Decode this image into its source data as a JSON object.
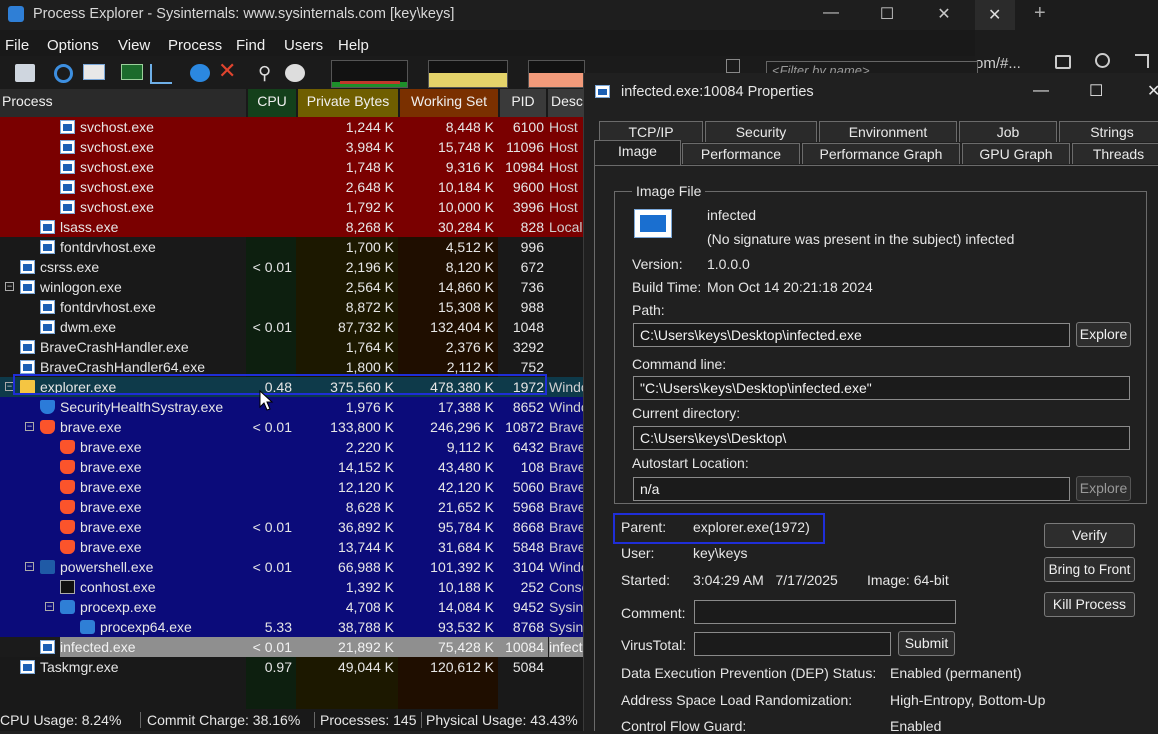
{
  "window": {
    "title": "Process Explorer - Sysinternals: www.sysinternals.com [key\\keys]",
    "minimize": "—",
    "maximize": "☐",
    "close": "✕"
  },
  "browser": {
    "close_tab": "✕",
    "new_tab": "+",
    "url_fragment": "om/#...",
    "filter_placeholder": "<Filter by name>"
  },
  "menu": [
    "File",
    "Options",
    "View",
    "Process",
    "Find",
    "Users",
    "Help"
  ],
  "columns": {
    "process": "Process",
    "cpu": "CPU",
    "private": "Private Bytes",
    "working": "Working Set",
    "pid": "PID",
    "desc": "Desc"
  },
  "colors": {
    "service": "#7a0000",
    "user": "#0b0b7a",
    "immersive": "#0e3a4a",
    "new": "#8f8f8f",
    "cpu_col": "#0f2a12",
    "priv_col": "#3a3000",
    "ws_col": "#3d1a00"
  },
  "processes": [
    {
      "name": "svchost.exe",
      "cpu": "",
      "private": "1,244 K",
      "working": "8,448 K",
      "pid": "6100",
      "desc": "Host",
      "indent": 60,
      "icon": "app",
      "color": "service"
    },
    {
      "name": "svchost.exe",
      "cpu": "",
      "private": "3,984 K",
      "working": "15,748 K",
      "pid": "11096",
      "desc": "Host",
      "indent": 60,
      "icon": "app",
      "color": "service"
    },
    {
      "name": "svchost.exe",
      "cpu": "",
      "private": "1,748 K",
      "working": "9,316 K",
      "pid": "10984",
      "desc": "Host",
      "indent": 60,
      "icon": "app",
      "color": "service"
    },
    {
      "name": "svchost.exe",
      "cpu": "",
      "private": "2,648 K",
      "working": "10,184 K",
      "pid": "9600",
      "desc": "Host",
      "indent": 60,
      "icon": "app",
      "color": "service"
    },
    {
      "name": "svchost.exe",
      "cpu": "",
      "private": "1,792 K",
      "working": "10,000 K",
      "pid": "3996",
      "desc": "Host",
      "indent": 60,
      "icon": "app",
      "color": "service"
    },
    {
      "name": "lsass.exe",
      "cpu": "",
      "private": "8,268 K",
      "working": "30,284 K",
      "pid": "828",
      "desc": "Local",
      "indent": 40,
      "icon": "app",
      "color": "service"
    },
    {
      "name": "fontdrvhost.exe",
      "cpu": "",
      "private": "1,700 K",
      "working": "4,512 K",
      "pid": "996",
      "desc": "",
      "indent": 40,
      "icon": "app",
      "color": ""
    },
    {
      "name": "csrss.exe",
      "cpu": "< 0.01",
      "private": "2,196 K",
      "working": "8,120 K",
      "pid": "672",
      "desc": "",
      "indent": 20,
      "icon": "app",
      "color": ""
    },
    {
      "name": "winlogon.exe",
      "cpu": "",
      "private": "2,564 K",
      "working": "14,860 K",
      "pid": "736",
      "desc": "",
      "indent": 20,
      "icon": "app",
      "color": "",
      "toggle": "−"
    },
    {
      "name": "fontdrvhost.exe",
      "cpu": "",
      "private": "8,872 K",
      "working": "15,308 K",
      "pid": "988",
      "desc": "",
      "indent": 40,
      "icon": "app",
      "color": ""
    },
    {
      "name": "dwm.exe",
      "cpu": "< 0.01",
      "private": "87,732 K",
      "working": "132,404 K",
      "pid": "1048",
      "desc": "",
      "indent": 40,
      "icon": "app",
      "color": ""
    },
    {
      "name": "BraveCrashHandler.exe",
      "cpu": "",
      "private": "1,764 K",
      "working": "2,376 K",
      "pid": "3292",
      "desc": "",
      "indent": 20,
      "icon": "app",
      "color": ""
    },
    {
      "name": "BraveCrashHandler64.exe",
      "cpu": "",
      "private": "1,800 K",
      "working": "2,112 K",
      "pid": "752",
      "desc": "",
      "indent": 20,
      "icon": "app",
      "color": ""
    },
    {
      "name": "explorer.exe",
      "cpu": "0.48",
      "private": "375,560 K",
      "working": "478,380 K",
      "pid": "1972",
      "desc": "Windo",
      "indent": 20,
      "icon": "folder",
      "color": "immersive",
      "toggle": "−"
    },
    {
      "name": "SecurityHealthSystray.exe",
      "cpu": "",
      "private": "1,976 K",
      "working": "17,388 K",
      "pid": "8652",
      "desc": "Windo",
      "indent": 40,
      "icon": "shield",
      "color": "user"
    },
    {
      "name": "brave.exe",
      "cpu": "< 0.01",
      "private": "133,800 K",
      "working": "246,296 K",
      "pid": "10872",
      "desc": "Brave",
      "indent": 40,
      "icon": "brave",
      "color": "user",
      "toggle": "−"
    },
    {
      "name": "brave.exe",
      "cpu": "",
      "private": "2,220 K",
      "working": "9,112 K",
      "pid": "6432",
      "desc": "Brave",
      "indent": 60,
      "icon": "brave",
      "color": "user"
    },
    {
      "name": "brave.exe",
      "cpu": "",
      "private": "14,152 K",
      "working": "43,480 K",
      "pid": "108",
      "desc": "Brave",
      "indent": 60,
      "icon": "brave",
      "color": "user"
    },
    {
      "name": "brave.exe",
      "cpu": "",
      "private": "12,120 K",
      "working": "42,120 K",
      "pid": "5060",
      "desc": "Brave",
      "indent": 60,
      "icon": "brave",
      "color": "user"
    },
    {
      "name": "brave.exe",
      "cpu": "",
      "private": "8,628 K",
      "working": "21,652 K",
      "pid": "5968",
      "desc": "Brave",
      "indent": 60,
      "icon": "brave",
      "color": "user"
    },
    {
      "name": "brave.exe",
      "cpu": "< 0.01",
      "private": "36,892 K",
      "working": "95,784 K",
      "pid": "8668",
      "desc": "Brave",
      "indent": 60,
      "icon": "brave",
      "color": "user"
    },
    {
      "name": "brave.exe",
      "cpu": "",
      "private": "13,744 K",
      "working": "31,684 K",
      "pid": "5848",
      "desc": "Brave",
      "indent": 60,
      "icon": "brave",
      "color": "user"
    },
    {
      "name": "powershell.exe",
      "cpu": "< 0.01",
      "private": "66,988 K",
      "working": "101,392 K",
      "pid": "3104",
      "desc": "Windo",
      "indent": 40,
      "icon": "ps",
      "color": "user",
      "toggle": "−"
    },
    {
      "name": "conhost.exe",
      "cpu": "",
      "private": "1,392 K",
      "working": "10,188 K",
      "pid": "252",
      "desc": "Conso",
      "indent": 60,
      "icon": "con",
      "color": "user"
    },
    {
      "name": "procexp.exe",
      "cpu": "",
      "private": "4,708 K",
      "working": "14,084 K",
      "pid": "9452",
      "desc": "Sysint",
      "indent": 60,
      "icon": "pe",
      "color": "user",
      "toggle": "−"
    },
    {
      "name": "procexp64.exe",
      "cpu": "5.33",
      "private": "38,788 K",
      "working": "93,532 K",
      "pid": "8768",
      "desc": "Sysint",
      "indent": 80,
      "icon": "pe",
      "color": "user"
    },
    {
      "name": "infected.exe",
      "cpu": "< 0.01",
      "private": "21,892 K",
      "working": "75,428 K",
      "pid": "10084",
      "desc": "infect",
      "indent": 40,
      "icon": "app",
      "color": "new"
    },
    {
      "name": "Taskmgr.exe",
      "cpu": "0.97",
      "private": "49,044 K",
      "working": "120,612 K",
      "pid": "5084",
      "desc": "",
      "indent": 20,
      "icon": "app",
      "color": ""
    }
  ],
  "status": {
    "cpu": "CPU Usage: 8.24%",
    "commit": "Commit Charge: 38.16%",
    "processes": "Processes: 145",
    "physical": "Physical Usage: 43.43%"
  },
  "props": {
    "title": "infected.exe:10084 Properties",
    "tabs_top": [
      "TCP/IP",
      "Security",
      "Environment",
      "Job",
      "Strings"
    ],
    "tabs_bottom": [
      "Image",
      "Performance",
      "Performance Graph",
      "GPU Graph",
      "Threads"
    ],
    "group": "Image File",
    "name": "infected",
    "signature": "(No signature was present in the subject) infected",
    "version_label": "Version:",
    "version": "1.0.0.0",
    "build_label": "Build Time:",
    "build": "Mon Oct 14 20:21:18 2024",
    "path_label": "Path:",
    "path": "C:\\Users\\keys\\Desktop\\infected.exe",
    "explore": "Explore",
    "cmd_label": "Command line:",
    "cmd": "\"C:\\Users\\keys\\Desktop\\infected.exe\"",
    "curdir_label": "Current directory:",
    "curdir": "C:\\Users\\keys\\Desktop\\",
    "autostart_label": "Autostart Location:",
    "autostart": "n/a",
    "parent_label": "Parent:",
    "parent": "explorer.exe(1972)",
    "user_label": "User:",
    "user": "key\\keys",
    "started_label": "Started:",
    "started": "3:04:29 AM   7/17/2025",
    "image_bits": "Image: 64-bit",
    "comment_label": "Comment:",
    "virustotal_label": "VirusTotal:",
    "submit": "Submit",
    "verify": "Verify",
    "bring_front": "Bring to Front",
    "kill": "Kill Process",
    "dep_label": "Data Execution Prevention (DEP) Status:",
    "dep": "Enabled (permanent)",
    "aslr_label": "Address Space Load Randomization:",
    "aslr": "High-Entropy, Bottom-Up",
    "cfg_label": "Control Flow Guard:",
    "cfg": "Enabled"
  }
}
